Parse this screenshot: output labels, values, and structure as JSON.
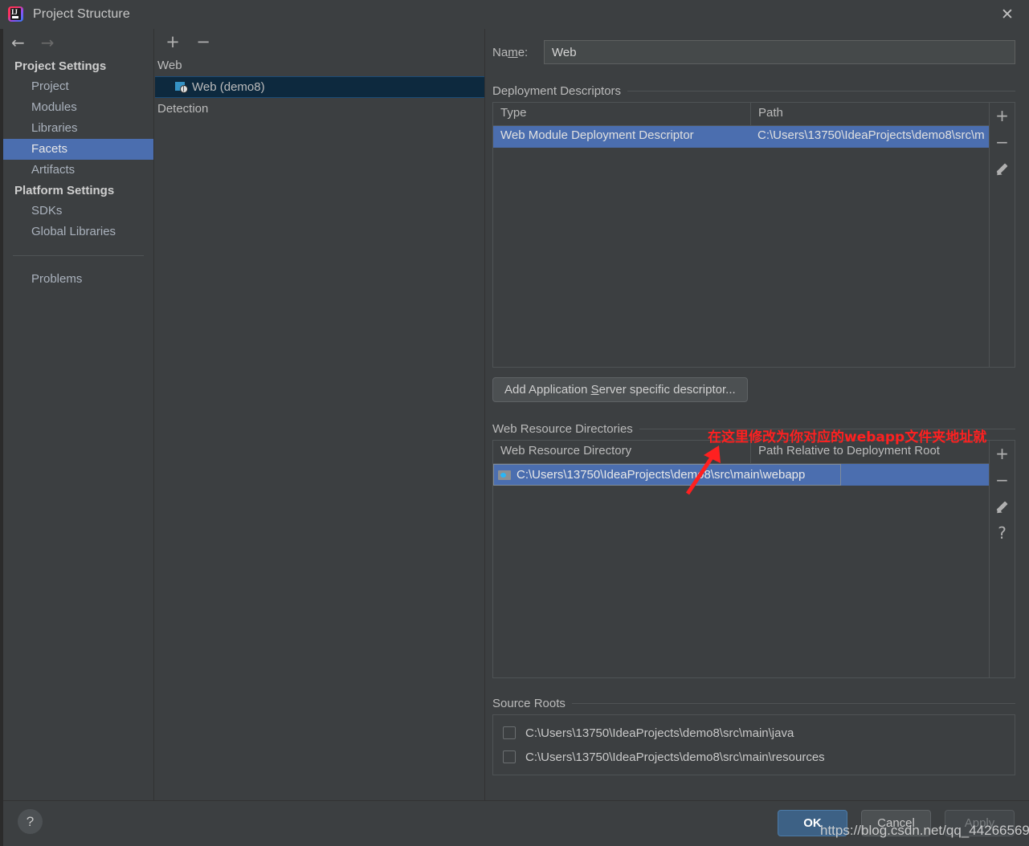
{
  "window": {
    "title": "Project Structure",
    "app_icon": "intellij-idea-icon",
    "close_icon": "✕"
  },
  "nav": {
    "back_icon": "←",
    "forward_icon": "→"
  },
  "sidebar": {
    "groups": [
      {
        "label": "Project Settings",
        "items": [
          {
            "label": "Project",
            "selected": false
          },
          {
            "label": "Modules",
            "selected": false
          },
          {
            "label": "Libraries",
            "selected": false
          },
          {
            "label": "Facets",
            "selected": true
          },
          {
            "label": "Artifacts",
            "selected": false
          }
        ]
      },
      {
        "label": "Platform Settings",
        "items": [
          {
            "label": "SDKs",
            "selected": false
          },
          {
            "label": "Global Libraries",
            "selected": false
          }
        ]
      }
    ],
    "problems_label": "Problems"
  },
  "tree": {
    "toolbar": {
      "add_icon": "+",
      "remove_icon": "−"
    },
    "rows": [
      {
        "label": "Web",
        "child": false,
        "selected": false
      },
      {
        "label": "Web (demo8)",
        "child": true,
        "selected": true
      },
      {
        "label": "Detection",
        "child": false,
        "selected": false
      }
    ]
  },
  "facet": {
    "name_label_pre": "Na",
    "name_label_mid": "m",
    "name_label_post": "e:",
    "name_value": "Web",
    "deployment": {
      "title": "Deployment Descriptors",
      "columns": [
        "Type",
        "Path"
      ],
      "rows": [
        {
          "type": "Web Module Deployment Descriptor",
          "path": "C:\\Users\\13750\\IdeaProjects\\demo8\\src\\m",
          "selected": true
        }
      ],
      "tools": [
        "+",
        "−",
        "pencil-icon"
      ],
      "add_button_pre": "Add Application ",
      "add_button_accel": "S",
      "add_button_post": "erver specific descriptor..."
    },
    "web_resources": {
      "title": "Web Resource Directories",
      "columns": [
        "Web Resource Directory",
        "Path Relative to Deployment Root"
      ],
      "rows": [
        {
          "directory": "C:\\Users\\13750\\IdeaProjects\\demo8\\src\\main\\webapp",
          "relative_path": "",
          "selected": true
        }
      ],
      "tools": [
        "+",
        "−",
        "pencil-icon",
        "?"
      ]
    },
    "source_roots": {
      "title": "Source Roots",
      "items": [
        {
          "path": "C:\\Users\\13750\\IdeaProjects\\demo8\\src\\main\\java",
          "checked": false
        },
        {
          "path": "C:\\Users\\13750\\IdeaProjects\\demo8\\src\\main\\resources",
          "checked": false
        }
      ]
    }
  },
  "footer": {
    "help_icon": "?",
    "ok_label": "OK",
    "cancel_label": "Cancel",
    "apply_label": "Apply"
  },
  "annotation": {
    "text": "在这里修改为你对应的webapp文件夹地址就",
    "color": "#ff2020"
  },
  "watermark": {
    "text": "https://blog.csdn.net/qq_44266569"
  },
  "colors": {
    "window_bg": "#3c3f41",
    "selection_blue": "#4b6eaf",
    "tree_selection": "#0d293e",
    "accent_primary": "#3d6185",
    "annotation_red": "#ff2020"
  }
}
